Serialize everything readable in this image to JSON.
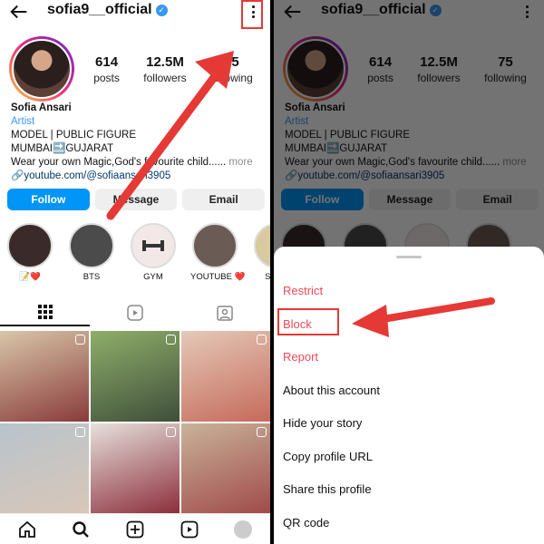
{
  "profile": {
    "username": "sofia9__official",
    "stats": [
      {
        "num": "614",
        "label": "posts"
      },
      {
        "num": "12.5M",
        "label": "followers"
      },
      {
        "num": "75",
        "label": "following"
      }
    ],
    "bio": {
      "name": "Sofia Ansari",
      "category": "Artist",
      "line1": "MODEL | PUBLIC FIGURE",
      "line2": "MUMBAI🔜GUJARAT",
      "line3": "Wear your own Magic,God's favourite child......",
      "more": "more",
      "link": "youtube.com/@sofiaansari3905"
    },
    "buttons": {
      "follow": "Follow",
      "message": "Message",
      "email": "Email"
    },
    "highlights": [
      {
        "label": "📝❤️",
        "color": "#3a2a2a"
      },
      {
        "label": "BTS",
        "color": "#4b4b4b"
      },
      {
        "label": "GYM",
        "color": "#f3e8e8"
      },
      {
        "label": "YOUTUBE ❤️",
        "color": "#6b5b55"
      },
      {
        "label": "SNAP",
        "color": "#d9c9a0"
      }
    ],
    "grid_colors": [
      "#8a3b3b",
      "#4f6b3a",
      "#c66a5a",
      "#d9c6b8",
      "#8c2d3a",
      "#a04a4a"
    ]
  },
  "menu": {
    "items": [
      {
        "label": "Restrict",
        "red": true
      },
      {
        "label": "Block",
        "red": true
      },
      {
        "label": "Report",
        "red": true
      },
      {
        "label": "About this account",
        "red": false
      },
      {
        "label": "Hide your story",
        "red": false
      },
      {
        "label": "Copy profile URL",
        "red": false
      },
      {
        "label": "Share this profile",
        "red": false
      },
      {
        "label": "QR code",
        "red": false
      }
    ]
  },
  "colors": {
    "accent": "#0095f6",
    "annotation": "#e53935",
    "danger": "#ed4956"
  },
  "icons": [
    "back-arrow-icon",
    "verified-icon",
    "more-options-icon",
    "grid-icon",
    "reels-icon",
    "tagged-icon",
    "home-icon",
    "search-icon",
    "create-icon",
    "reels-nav-icon",
    "profile-icon"
  ]
}
